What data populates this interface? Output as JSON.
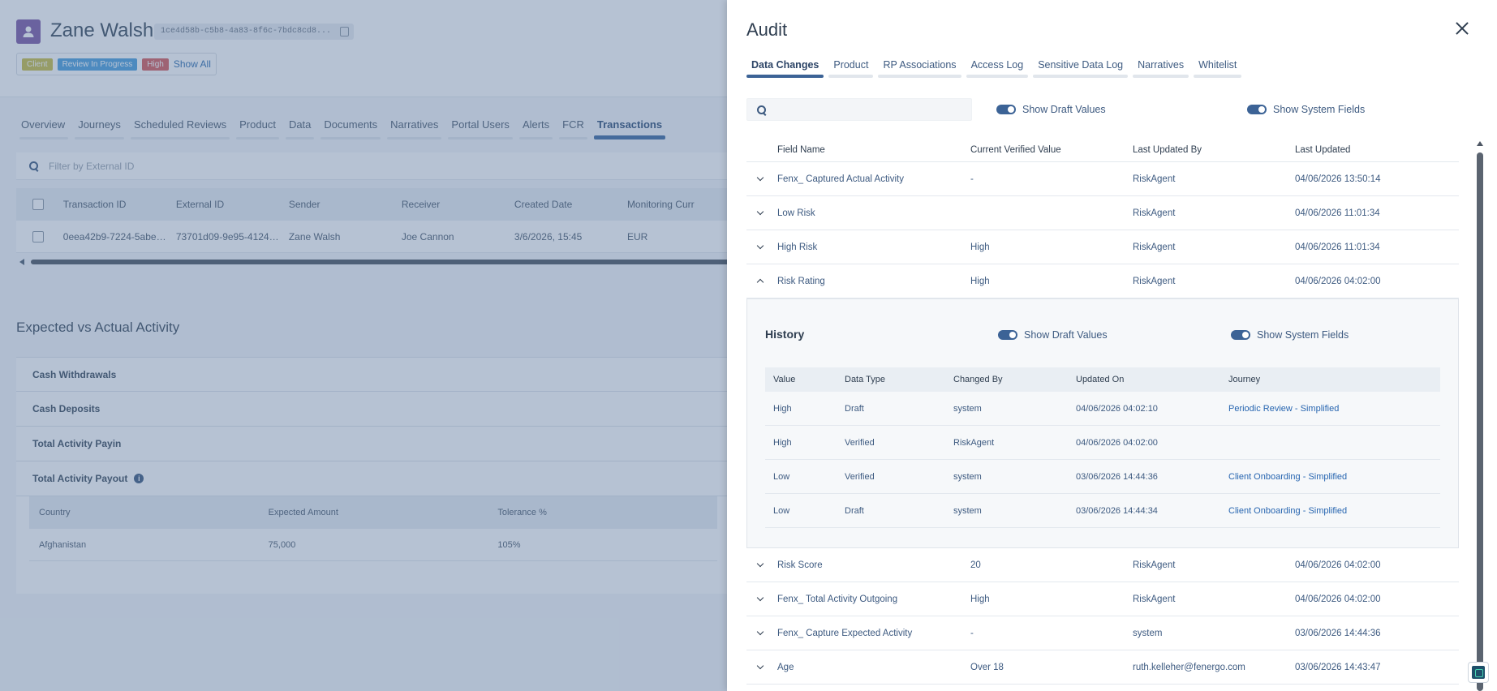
{
  "client": {
    "name": "Zane Walsh",
    "id": "1ce4d58b-c5b8-4a83-8f6c-7bdc8cd8...",
    "tags": [
      "Client",
      "Review In Progress",
      "High"
    ],
    "show_all": "Show All"
  },
  "client_tabs": [
    "Overview",
    "Journeys",
    "Scheduled Reviews",
    "Product",
    "Data",
    "Documents",
    "Narratives",
    "Portal Users",
    "Alerts",
    "FCR",
    "Transactions"
  ],
  "active_client_tab": "Transactions",
  "transactions": {
    "filter_placeholder": "Filter by External ID",
    "columns": [
      "Transaction ID",
      "External ID",
      "Sender",
      "Receiver",
      "Created Date",
      "Monitoring Curr"
    ],
    "rows": [
      [
        "0eea42b9-7224-5abe-9f...",
        "73701d09-9e95-4124-9...",
        "Zane Walsh",
        "Joe Cannon",
        "3/6/2026, 15:45",
        "EUR"
      ]
    ]
  },
  "expected_activity": {
    "title": "Expected vs Actual Activity",
    "sections": [
      "Cash Withdrawals",
      "Cash Deposits",
      "Total Activity Payin",
      "Total Activity Payout"
    ],
    "payout_columns": [
      "Country",
      "Expected Amount",
      "Tolerance %"
    ],
    "payout_rows": [
      [
        "Afghanistan",
        "75,000",
        "105%"
      ]
    ]
  },
  "audit": {
    "title": "Audit",
    "tabs": [
      "Data Changes",
      "Product",
      "RP Associations",
      "Access Log",
      "Sensitive Data Log",
      "Narratives",
      "Whitelist"
    ],
    "active_tab": "Data Changes",
    "search_value": "",
    "show_draft_label": "Show Draft Values",
    "show_system_label": "Show System Fields",
    "show_draft": true,
    "show_system": true,
    "columns": [
      "Field Name",
      "Current Verified Value",
      "Last Updated By",
      "Last Updated"
    ],
    "rows_before": [
      {
        "field": "Fenx_ Captured Actual Activity",
        "value": "-",
        "by": "RiskAgent",
        "updated": "04/06/2026 13:50:14"
      },
      {
        "field": "Low Risk",
        "value": "",
        "by": "RiskAgent",
        "updated": "04/06/2026 11:01:34"
      },
      {
        "field": "High Risk",
        "value": "High",
        "by": "RiskAgent",
        "updated": "04/06/2026 11:01:34"
      },
      {
        "field": "Risk Rating",
        "value": "High",
        "by": "RiskAgent",
        "updated": "04/06/2026 04:02:00"
      }
    ],
    "history": {
      "title": "History",
      "show_draft_label": "Show Draft Values",
      "show_system_label": "Show System Fields",
      "columns": [
        "Value",
        "Data Type",
        "Changed By",
        "Updated On",
        "Journey"
      ],
      "rows": [
        {
          "value": "High",
          "type": "Draft",
          "by": "system",
          "on": "04/06/2026 04:02:10",
          "journey": "Periodic Review - Simplified"
        },
        {
          "value": "High",
          "type": "Verified",
          "by": "RiskAgent",
          "on": "04/06/2026 04:02:00",
          "journey": ""
        },
        {
          "value": "Low",
          "type": "Verified",
          "by": "system",
          "on": "03/06/2026 14:44:36",
          "journey": "Client Onboarding - Simplified"
        },
        {
          "value": "Low",
          "type": "Draft",
          "by": "system",
          "on": "03/06/2026 14:44:34",
          "journey": "Client Onboarding - Simplified"
        }
      ]
    },
    "rows_after": [
      {
        "field": "Risk Score",
        "value": "20",
        "by": "RiskAgent",
        "updated": "04/06/2026 04:02:00"
      },
      {
        "field": "Fenx_ Total Activity Outgoing",
        "value": "High",
        "by": "RiskAgent",
        "updated": "04/06/2026 04:02:00"
      },
      {
        "field": "Fenx_ Capture Expected Activity",
        "value": "-",
        "by": "system",
        "updated": "03/06/2026 14:44:36"
      },
      {
        "field": "Age",
        "value": "Over 18",
        "by": "ruth.kelleher@fenergo.com",
        "updated": "03/06/2026 14:43:47"
      }
    ]
  }
}
